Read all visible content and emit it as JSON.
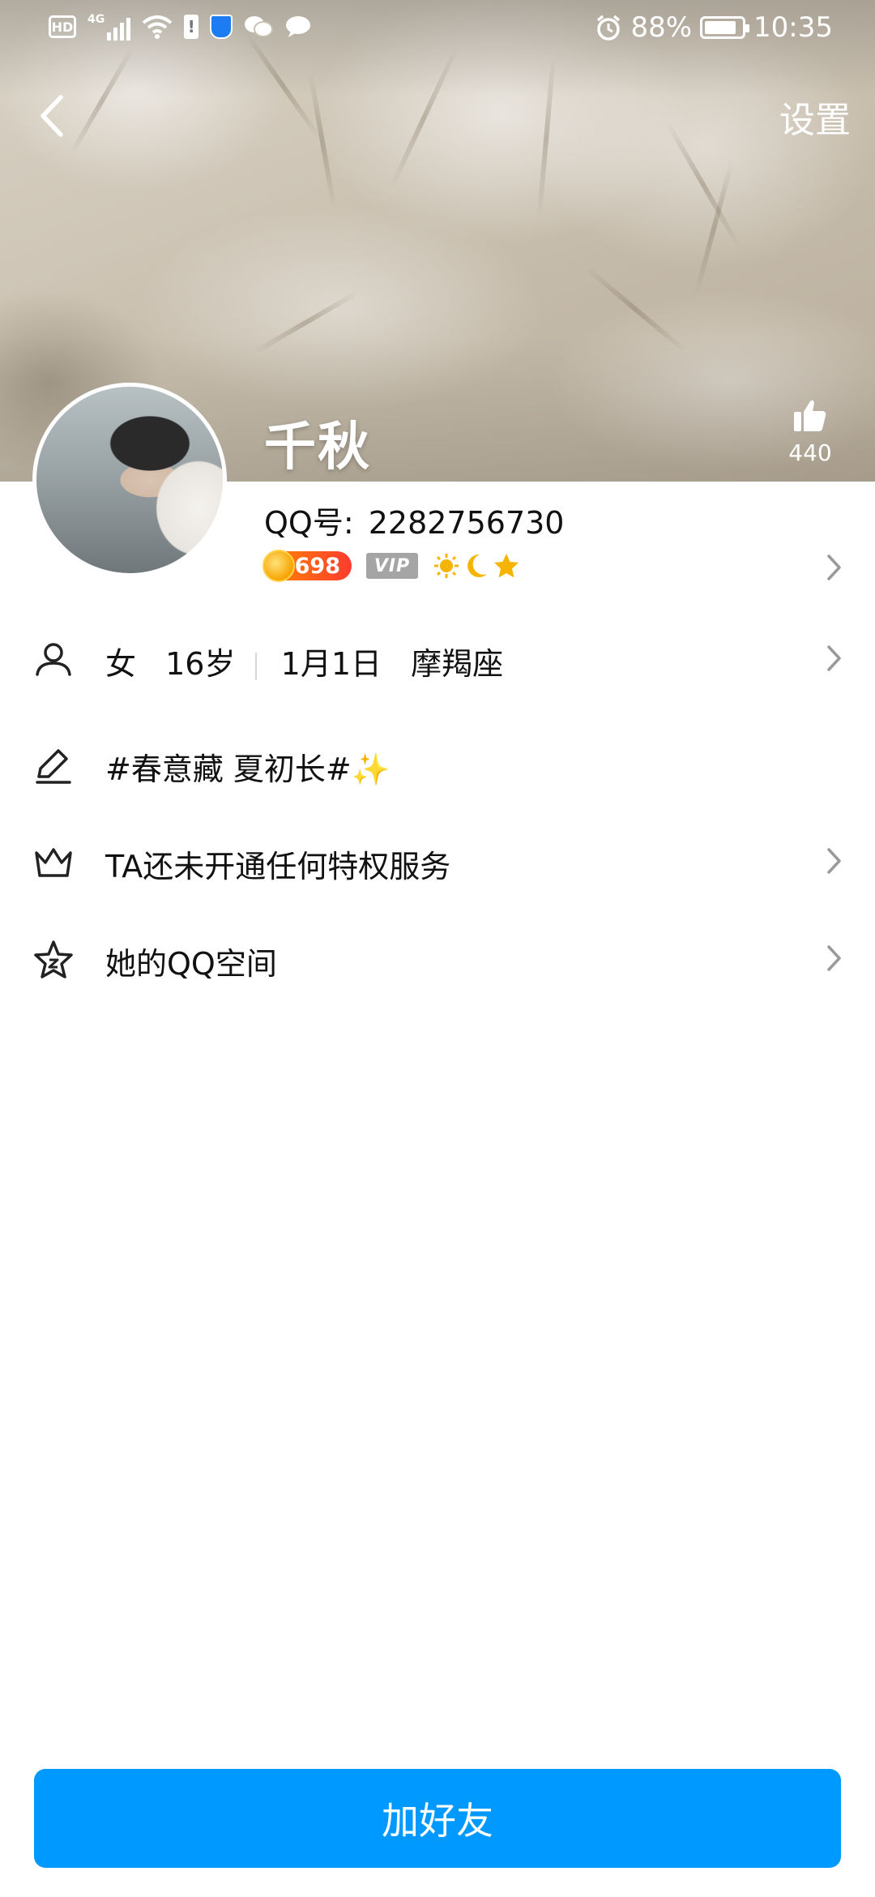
{
  "status_bar": {
    "hd": "HD",
    "network": "4G",
    "battery_percent": "88%",
    "time": "10:35"
  },
  "header": {
    "back_icon": "chevron-left-icon",
    "settings_label": "设置",
    "nickname": "千秋",
    "likes": "440"
  },
  "profile": {
    "qq_label": "QQ号:",
    "qq_number": "2282756730",
    "level": "698",
    "vip_label": "VIP"
  },
  "rows": {
    "gender": "女",
    "age": "16岁",
    "birthday": "1月1日",
    "zodiac": "摩羯座",
    "signature": "#春意藏 夏初长#✨",
    "privilege": "TA还未开通任何特权服务",
    "qzone": "她的QQ空间"
  },
  "actions": {
    "add_friend": "加好友"
  },
  "colors": {
    "accent": "#0099ff",
    "signature": "#1d8fe1",
    "level_badge": "#ff5a1f"
  }
}
